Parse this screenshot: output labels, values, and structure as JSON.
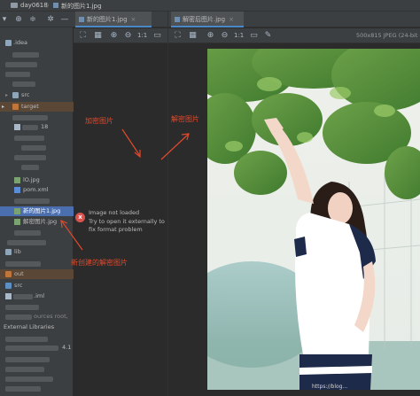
{
  "titlebar": {
    "project": "day0618",
    "sep": "〉",
    "file": "新的图片1.jpg"
  },
  "tree": {
    "idea": ".idea",
    "src": "src",
    "target": "target",
    "partial_18": "18",
    "jpg1": "lO.jpg",
    "pom": "pom.xml",
    "sel_file": "新的图片1.jpg",
    "decrypted_file": "解密图片.jpg",
    "lib": "lib",
    "out": "out",
    "src2": "src",
    "iml": ".iml",
    "sources_root": "ources root,",
    "external": "External Libraries",
    "ver": "4.1"
  },
  "tabs": {
    "left": "新的图片1.jpg",
    "right": "解密后图片.jpg",
    "close": "×"
  },
  "img_toolbar": {
    "ratio": "1:1",
    "info": "500x815 JPEG (24-bit c"
  },
  "annotations": {
    "encrypt": "加密图片",
    "decrypt": "解密图片",
    "new_decrypt": "新创建的解密图片"
  },
  "error": {
    "icon": "x",
    "title": "Image not loaded",
    "line2": "Try to open it externally to",
    "line3": "fix format problem"
  },
  "watermark": "https://blog...",
  "colors": {
    "accent_red": "#e0492c",
    "selection": "#4b6eaf",
    "panel": "#3c3f41",
    "editor": "#2b2b2b"
  }
}
